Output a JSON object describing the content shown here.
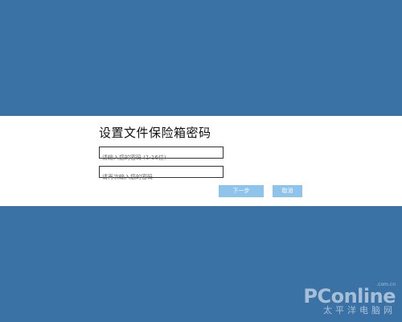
{
  "dialog": {
    "title": "设置文件保险箱密码",
    "password_field": {
      "value": "",
      "placeholder": "请输入您的密码 (1-16位)"
    },
    "confirm_field": {
      "value": "",
      "placeholder": "请再次输入您的密码"
    },
    "next_button_label": "下一步",
    "cancel_button_label": "取消"
  },
  "watermark": {
    "brand": "PConline",
    "domain": ".com.cn",
    "slogan": "太平洋电脑网"
  },
  "colors": {
    "background": "#3a72a6",
    "dialog_band": "#ffffff",
    "button": "#8ec3ec",
    "button_text": "#ffffff"
  }
}
